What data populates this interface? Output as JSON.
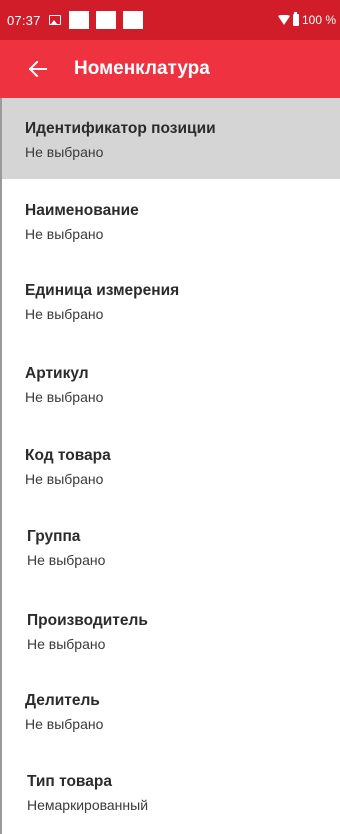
{
  "status_bar": {
    "time": "07:37",
    "battery": "100 %",
    "icons": [
      "image-notification-icon",
      "app-notification-icon",
      "app-notification-icon",
      "app-notification-icon",
      "wifi-icon",
      "battery-icon"
    ]
  },
  "app_bar": {
    "title": "Номенклатура",
    "back_icon": "arrow-left-icon",
    "color": "#ee3240"
  },
  "fields": [
    {
      "label": "Идентификатор позиции",
      "value": "Не выбрано"
    },
    {
      "label": "Наименование",
      "value": "Не выбрано"
    },
    {
      "label": "Единица измерения",
      "value": "Не выбрано"
    },
    {
      "label": "Артикул",
      "value": "Не выбрано"
    },
    {
      "label": "Код товара",
      "value": "Не выбрано"
    },
    {
      "label": "Группа",
      "value": "Не выбрано"
    },
    {
      "label": "Производитель",
      "value": "Не выбрано"
    },
    {
      "label": "Делитель",
      "value": "Не выбрано"
    },
    {
      "label": "Тип товара",
      "value": "Немаркированный"
    }
  ]
}
